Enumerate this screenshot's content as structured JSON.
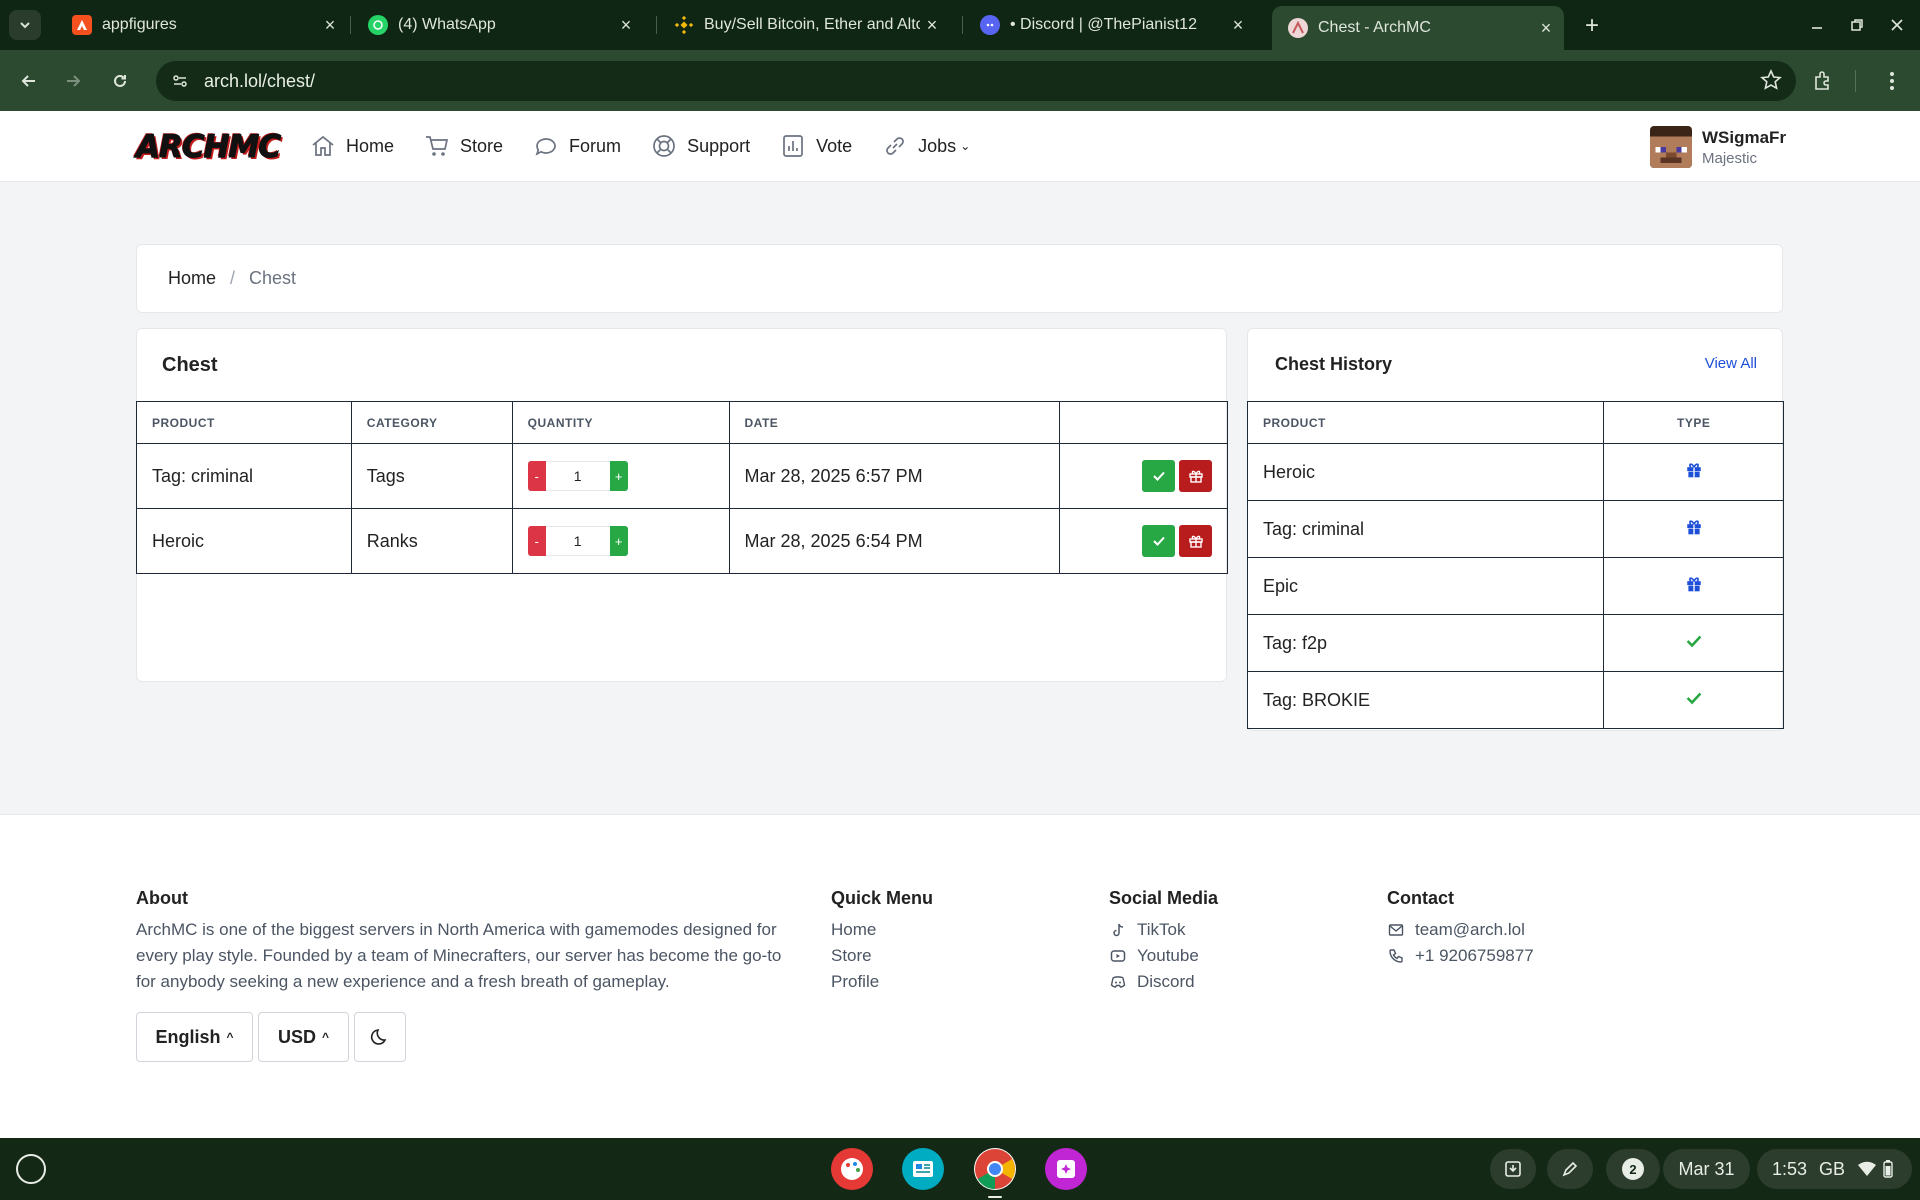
{
  "browser": {
    "tabs": [
      {
        "title": "appfigures",
        "favicon": "appfigures-icon",
        "color": "#f4511e"
      },
      {
        "title": "(4) WhatsApp",
        "favicon": "whatsapp-icon",
        "color": "#25d366"
      },
      {
        "title": "Buy/Sell Bitcoin, Ether and Altcoins",
        "favicon": "binance-icon",
        "color": "#f0b90b"
      },
      {
        "title": "• Discord | @ThePianist12",
        "favicon": "discord-icon",
        "color": "#5865f2"
      },
      {
        "title": "Chest - ArchMC",
        "favicon": "archmc-icon",
        "color": "#c45a5a"
      }
    ],
    "url": "arch.lol/chest/"
  },
  "nav": {
    "logo": "ARCHMC",
    "links": [
      {
        "label": "Home",
        "icon": "home-icon"
      },
      {
        "label": "Store",
        "icon": "cart-icon"
      },
      {
        "label": "Forum",
        "icon": "chat-icon"
      },
      {
        "label": "Support",
        "icon": "lifebuoy-icon"
      },
      {
        "label": "Vote",
        "icon": "chart-icon"
      },
      {
        "label": "Jobs",
        "icon": "link-icon"
      }
    ],
    "user": {
      "name": "WSigmaFr",
      "rank": "Majestic"
    }
  },
  "breadcrumb": {
    "home": "Home",
    "separator": "/",
    "current": "Chest"
  },
  "chest": {
    "title": "Chest",
    "columns": [
      "PRODUCT",
      "CATEGORY",
      "QUANTITY",
      "DATE",
      ""
    ],
    "rows": [
      {
        "product": "Tag: criminal",
        "category": "Tags",
        "quantity": "1",
        "date": "Mar 28, 2025 6:57 PM"
      },
      {
        "product": "Heroic",
        "category": "Ranks",
        "quantity": "1",
        "date": "Mar 28, 2025 6:54 PM"
      }
    ],
    "minus": "-",
    "plus": "+"
  },
  "history": {
    "title": "Chest History",
    "view_all": "View All",
    "columns": [
      "PRODUCT",
      "TYPE"
    ],
    "rows": [
      {
        "product": "Heroic",
        "type": "gift-icon"
      },
      {
        "product": "Tag: criminal",
        "type": "gift-icon"
      },
      {
        "product": "Epic",
        "type": "gift-icon"
      },
      {
        "product": "Tag: f2p",
        "type": "check-icon"
      },
      {
        "product": "Tag: BROKIE",
        "type": "check-icon"
      }
    ]
  },
  "footer": {
    "about_title": "About",
    "about_text": "ArchMC is one of the biggest servers in North America with gamemodes designed for every play style. Founded by a team of Minecrafters, our server has become the go-to for anybody seeking a new experience and a fresh breath of gameplay.",
    "quick_title": "Quick Menu",
    "quick_links": [
      "Home",
      "Store",
      "Profile"
    ],
    "social_title": "Social Media",
    "social_links": [
      {
        "label": "TikTok",
        "icon": "tiktok-icon"
      },
      {
        "label": "Youtube",
        "icon": "youtube-icon"
      },
      {
        "label": "Discord",
        "icon": "discord-icon"
      }
    ],
    "contact_title": "Contact",
    "email": "team@arch.lol",
    "phone": "+1 9206759877",
    "language": "English",
    "currency": "USD"
  },
  "shelf": {
    "date": "Mar 31",
    "time": "1:53",
    "region": "GB",
    "notifications": "2"
  },
  "colors": {
    "accent_green": "#28a745",
    "danger_red": "#dc3545",
    "gift_red": "#b91c1c",
    "link_blue": "#1d4ed8",
    "chrome_green": "#2b4a2f"
  }
}
